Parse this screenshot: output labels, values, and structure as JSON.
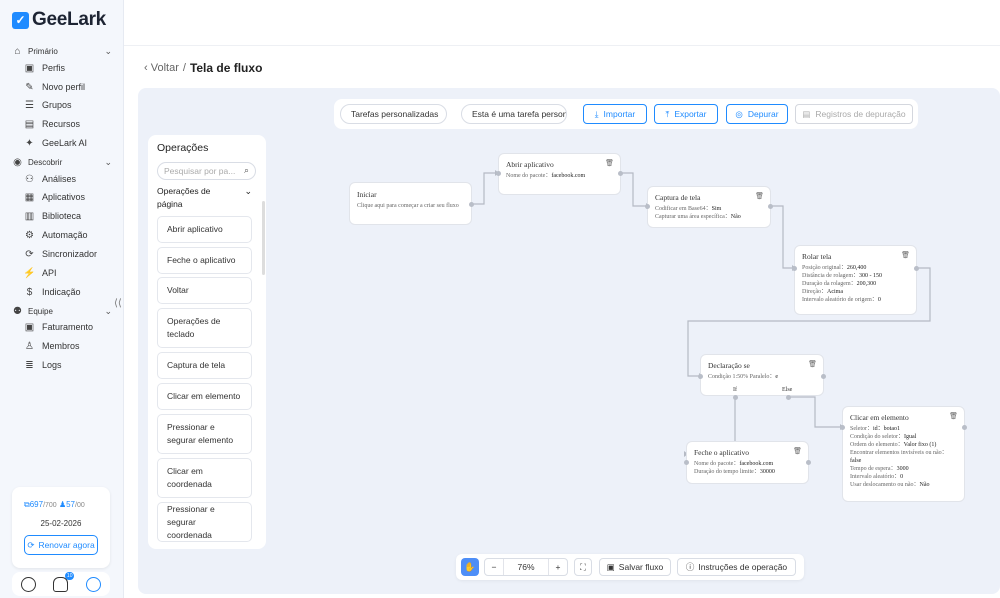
{
  "brand": {
    "name": "GeeLark",
    "accent": "#1f8bff"
  },
  "sidebar": {
    "sections": [
      {
        "label": "Primário",
        "icon": "home-icon"
      },
      {
        "label": "Descobrir",
        "icon": "compass-icon"
      },
      {
        "label": "Equipe",
        "icon": "team-icon"
      }
    ],
    "items": [
      {
        "label": "Perfis",
        "icon": "profiles-icon"
      },
      {
        "label": "Novo perfil",
        "icon": "edit-icon"
      },
      {
        "label": "Grupos",
        "icon": "list-icon"
      },
      {
        "label": "Recursos",
        "icon": "resources-icon"
      },
      {
        "label": "GeeLark AI",
        "icon": "ai-icon"
      },
      {
        "label": "Análises",
        "icon": "analytics-icon"
      },
      {
        "label": "Aplicativos",
        "icon": "apps-icon"
      },
      {
        "label": "Biblioteca",
        "icon": "library-icon"
      },
      {
        "label": "Automação",
        "icon": "automation-icon"
      },
      {
        "label": "Sincronizador",
        "icon": "sync-icon"
      },
      {
        "label": "API",
        "icon": "api-icon"
      },
      {
        "label": "Indicação",
        "icon": "referral-icon"
      },
      {
        "label": "Faturamento",
        "icon": "billing-icon"
      },
      {
        "label": "Membros",
        "icon": "members-icon"
      },
      {
        "label": "Logs",
        "icon": "logs-icon"
      }
    ],
    "collapse": "⟨⟨",
    "quota": {
      "profiles_used": "697",
      "profiles_total": "/700",
      "members_used": "57",
      "members_total": "/00"
    },
    "date": "25-02-2026",
    "renew": "Renovar agora",
    "notification_count": "10"
  },
  "breadcrumb": {
    "back": "Voltar",
    "sep": "/",
    "current": "Tela de fluxo"
  },
  "toolbar": {
    "task_type": "Tarefas personalizadas",
    "task_desc": "Esta é uma tarefa persona",
    "import": "Importar",
    "export": "Exportar",
    "debug": "Depurar",
    "debug_logs": "Registros de depuração"
  },
  "operations": {
    "title": "Operações",
    "search_placeholder": "Pesquisar por pa...",
    "group": "Operações de página",
    "items": [
      "Abrir aplicativo",
      "Feche o aplicativo",
      "Voltar",
      "Operações de teclado",
      "Captura de tela",
      "Clicar em elemento",
      "Pressionar e segurar elemento",
      "Clicar em coordenada",
      "Pressionar e segurar coordenada"
    ]
  },
  "nodes": {
    "start": {
      "title": "Iniciar",
      "desc": "Clique aqui para começar a criar seu fluxo"
    },
    "open_app": {
      "title": "Abrir aplicativo",
      "l1": "Nome do pacote：",
      "v1": "facebook.com"
    },
    "screenshot": {
      "title": "Captura de tela",
      "l1": "Codificar em Base64：",
      "v1": "Sim",
      "l2": "Capturar uma área específica：",
      "v2": "Não"
    },
    "scroll": {
      "title": "Rolar tela",
      "l1": "Posição original：",
      "v1": "260,400",
      "l2": "Distância de rolagem：",
      "v2": "300 - 150",
      "l3": "Duração da rolagem：",
      "v3": "200,300",
      "l4": "Direção：",
      "v4": "Acima",
      "l5": "Intervalo aleatório de origem：",
      "v5": "0"
    },
    "if": {
      "title": "Declaração se",
      "l1": "Condição 1:50%",
      "l2": "Paralelo：",
      "v2": "e",
      "branch_true": "If",
      "branch_false": "Else"
    },
    "close_app": {
      "title": "Feche o aplicativo",
      "l1": "Nome do pacote：",
      "v1": "facebook.com",
      "l2": "Duração do tempo limite：",
      "v2": "30000"
    },
    "click": {
      "title": "Clicar em elemento",
      "l1": "Seletor：",
      "v1": "id：botao1",
      "l2": "Condição do seletor：",
      "v2": "Igual",
      "l3": "Ordem do elemento：",
      "v3": "Valor fixo (1)",
      "l4": "Encontrar elementos invisíveis ou não：",
      "v4": "false",
      "l5": "Tempo de espera：",
      "v5": "3000",
      "l6": "Intervalo aleatório：",
      "v6": "0",
      "l7": "Usar deslocamento ou não：",
      "v7": "Não"
    }
  },
  "zoom": {
    "value": "76%",
    "save": "Salvar fluxo",
    "help": "Instruções de operação"
  }
}
